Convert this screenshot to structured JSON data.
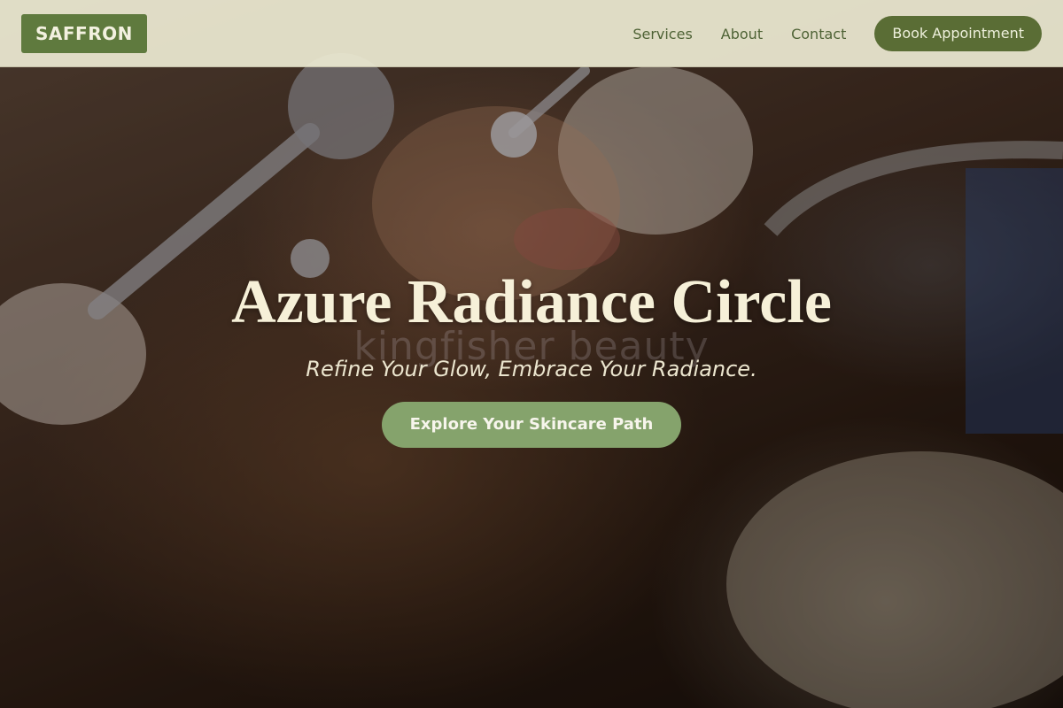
{
  "brand": {
    "logo_text": "SAFFRON"
  },
  "nav": {
    "links": [
      {
        "label": "Services"
      },
      {
        "label": "About"
      },
      {
        "label": "Contact"
      }
    ],
    "cta_label": "Book Appointment"
  },
  "hero": {
    "title": "Azure Radiance Circle",
    "watermark": "kingfisher beauty",
    "tagline": "Refine Your Glow, Embrace Your Radiance.",
    "cta_label": "Explore Your Skincare Path",
    "image_description_icon": "facial-treatment-photo"
  },
  "colors": {
    "header_bg": "#eceada",
    "brand_green": "#5f7a3e",
    "nav_text": "#4f6336",
    "book_button": "#5a6d35",
    "cta_button": "#85a36c",
    "hero_title": "#f6f0d8"
  }
}
